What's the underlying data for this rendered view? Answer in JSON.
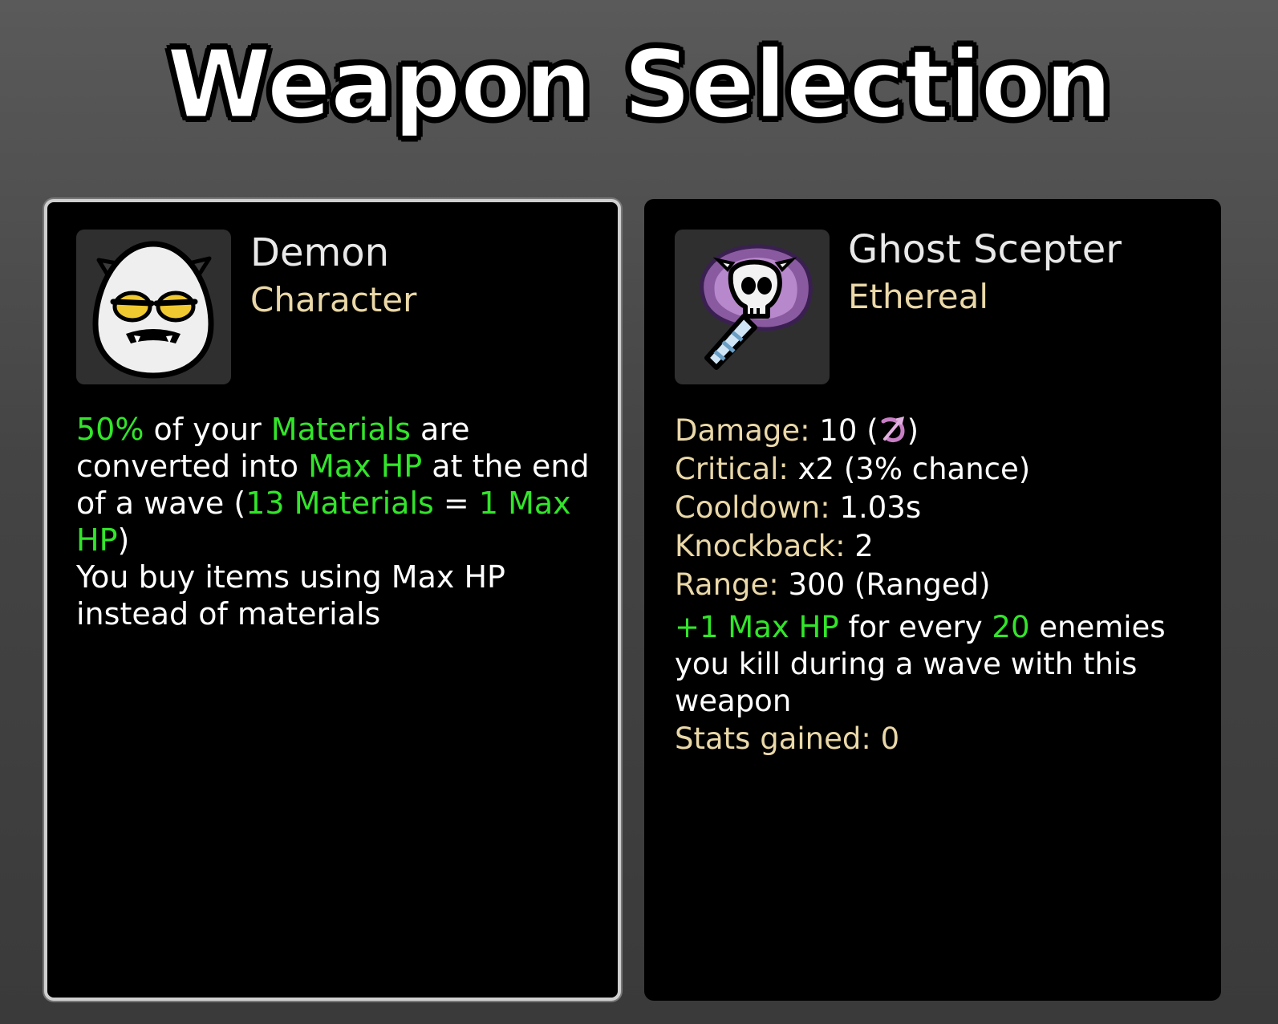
{
  "screen_title": "Weapon Selection",
  "character_card": {
    "name": "Demon",
    "type": "Character",
    "icon": "demon-egg-icon",
    "description": [
      {
        "text": "50%",
        "highlight": true
      },
      {
        "text": " of your ",
        "highlight": false
      },
      {
        "text": "Materials",
        "highlight": true
      },
      {
        "text": " are converted into ",
        "highlight": false
      },
      {
        "text": "Max HP",
        "highlight": true
      },
      {
        "text": " at the end of a wave (",
        "highlight": false
      },
      {
        "text": "13 Materials",
        "highlight": true
      },
      {
        "text": " = ",
        "highlight": false
      },
      {
        "text": "1 Max HP",
        "highlight": true
      },
      {
        "text": ")",
        "highlight": false
      }
    ],
    "description_line2": "You buy items using Max HP instead of materials"
  },
  "weapon_card": {
    "name": "Ghost Scepter",
    "type": "Ethereal",
    "icon": "ghost-scepter-icon",
    "stats": [
      {
        "label": "Damage",
        "value": "10 (",
        "suffix": ")",
        "has_icon": true,
        "icon": "elemental-scaling-icon"
      },
      {
        "label": "Critical",
        "value": "x2 (3% chance)"
      },
      {
        "label": "Cooldown",
        "value": "1.03s"
      },
      {
        "label": "Knockback",
        "value": "2"
      },
      {
        "label": "Range",
        "value": "300 (Ranged)"
      }
    ],
    "effect": [
      {
        "text": "+1 Max HP",
        "highlight": true
      },
      {
        "text": " for every ",
        "highlight": false
      },
      {
        "text": "20",
        "highlight": true
      },
      {
        "text": " enemies you kill during a wave with this weapon",
        "highlight": false
      }
    ],
    "stats_gained_label": "Stats gained",
    "stats_gained_value": "0"
  },
  "colors": {
    "highlight": "#32e52a",
    "stat_label": "#ead8a8",
    "selected_border": "#cfcfcf",
    "panel_bg": "#000000"
  }
}
